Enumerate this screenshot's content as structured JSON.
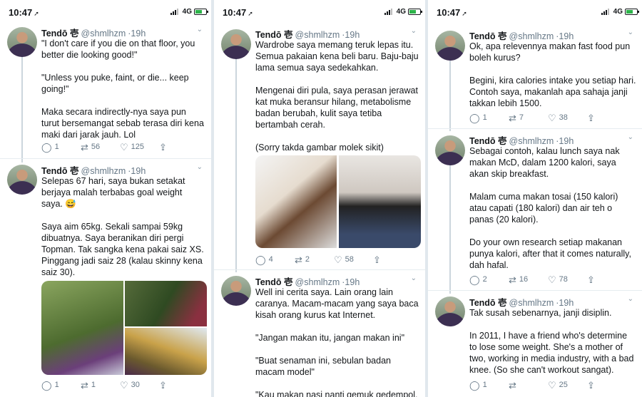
{
  "statusbar": {
    "time": "10:47",
    "network": "4G"
  },
  "colors": {
    "accent": "#1da1f2",
    "muted": "#657786",
    "divider": "#e6ecf0",
    "watermark": "#e82832"
  },
  "panels": [
    {
      "tweets": [
        {
          "name": "Tendō 壱",
          "handle": "@shmlhzm",
          "time": "19h",
          "text": "\"I don't care if you die on that floor, you better die looking good!\"\n\n\"Unless you puke, faint, or die... keep going!\"\n\nMaka secara indirectly-nya saya pun turut bersemangat sebab terasa diri kena maki dari jarak jauh. Lol",
          "replies": "1",
          "retweets": "56",
          "likes": "125"
        },
        {
          "name": "Tendō 壱",
          "handle": "@shmlhzm",
          "time": "19h",
          "text": "Selepas 67 hari, saya bukan setakat berjaya malah terbabas goal weight saya. 😅\n\nSaya aim 65kg. Sekali sampai 59kg dibuatnya. Saya beranikan diri pergi Topman. Tak sangka kena pakai saiz XS. Pinggang jadi saiz 28 (kalau skinny kena saiz 30).",
          "replies": "1",
          "retweets": "1",
          "likes": "30"
        }
      ]
    },
    {
      "tweets": [
        {
          "name": "Tendō 壱",
          "handle": "@shmlhzm",
          "time": "19h",
          "text": "Wardrobe saya memang teruk lepas itu. Semua pakaian kena beli baru. Baju-baju lama semua saya sedekahkan.\n\nMengenai diri pula, saya perasan jerawat kat muka beransur hilang, metabolisme badan berubah, kulit saya tetiba bertambah cerah.\n\n(Sorry takda gambar molek sikit)",
          "replies": "4",
          "retweets": "2",
          "likes": "58"
        },
        {
          "name": "Tendō 壱",
          "handle": "@shmlhzm",
          "time": "19h",
          "text": "Well ini cerita saya. Lain orang lain caranya. Macam-macam yang saya baca kisah orang kurus kat Internet.\n\n\"Jangan makan itu, jangan makan ini\"\n\n\"Buat senaman ini, sebulan badan macam model\"\n\n\"Kau makan nasi nanti gemuk gedempol."
        }
      ]
    },
    {
      "tweets": [
        {
          "name": "Tendō 壱",
          "handle": "@shmlhzm",
          "time": "19h",
          "text": "Ok, apa relevennya makan fast food pun boleh kurus?\n\nBegini, kira calories intake you setiap hari. Contoh saya, makanlah apa sahaja janji takkan lebih 1500.",
          "replies": "1",
          "retweets": "7",
          "likes": "38"
        },
        {
          "name": "Tendō 壱",
          "handle": "@shmlhzm",
          "time": "19h",
          "text": "Sebagai contoh, kalau lunch saya nak makan McD, dalam 1200 kalori, saya akan skip breakfast.\n\nMalam cuma makan tosai (150 kalori) atau capati (180 kalori) dan air teh o panas (20 kalori).\n\nDo your own research setiap makanan punya kalori, after that it comes naturally, dah hafal.",
          "replies": "2",
          "retweets": "16",
          "likes": "78"
        },
        {
          "name": "Tendō 壱",
          "handle": "@shmlhzm",
          "time": "19h",
          "text": "Tak susah sebenarnya, janji disiplin.\n\nIn 2011, I have a friend who's determine to lose some weight. She's a mother of two, working in media industry, with a bad knee. (So she can't workout sangat).",
          "replies": "1",
          "retweets": "",
          "likes": "25"
        }
      ]
    }
  ]
}
